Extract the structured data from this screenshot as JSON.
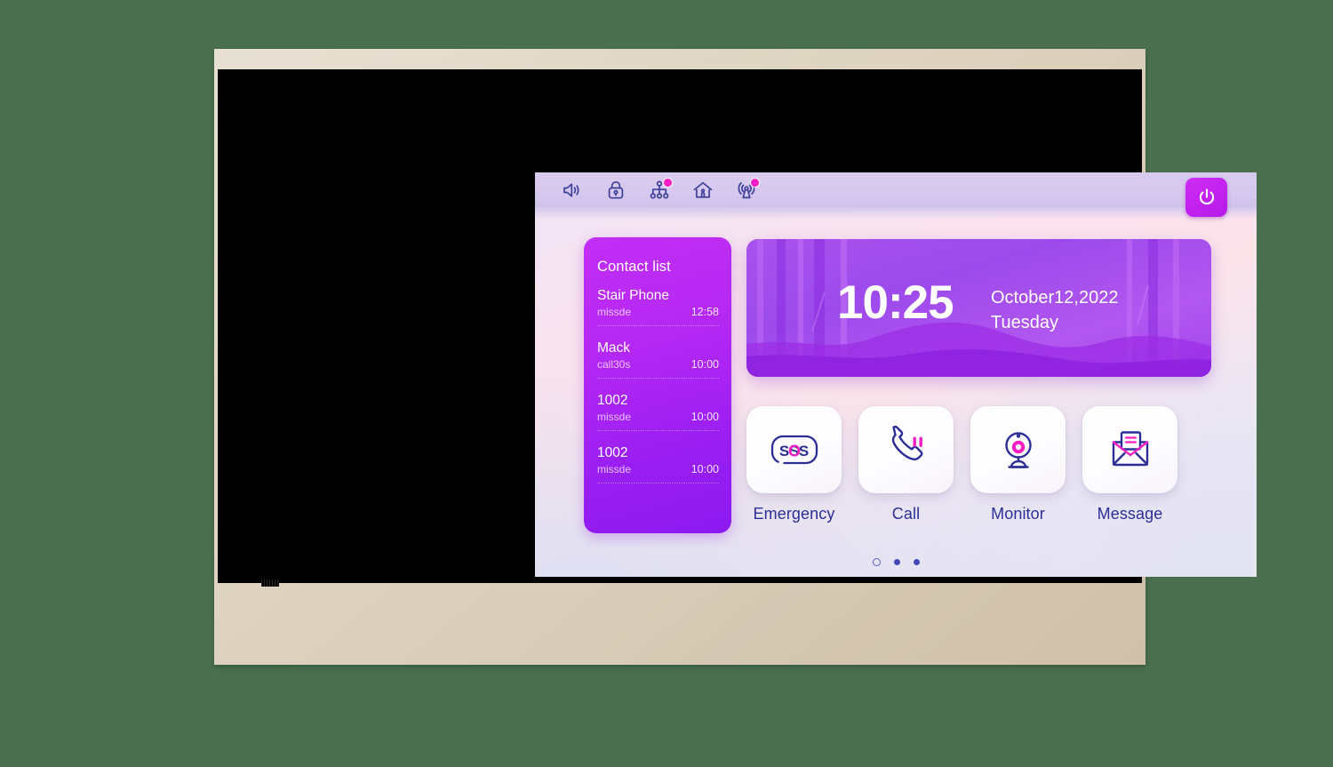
{
  "device": {
    "frame_color": "#ddd2bf",
    "bezel_color": "#000000",
    "speaker_grille": "speaker-grille"
  },
  "statusbar": {
    "background": "#d6c8ee",
    "icons": [
      {
        "name": "volume-icon",
        "label": "Volume",
        "badge": false
      },
      {
        "name": "lock-icon",
        "label": "Lock",
        "badge": false
      },
      {
        "name": "network-tree-icon",
        "label": "Network",
        "badge": true
      },
      {
        "name": "home-indoor-icon",
        "label": "Indoor Unit",
        "badge": false
      },
      {
        "name": "antenna-signal-icon",
        "label": "Signal",
        "badge": true
      }
    ],
    "badge_color": "#f81ec4",
    "power_button": {
      "name": "power-button",
      "label": "Power",
      "color": "#c322ef"
    }
  },
  "contact_panel": {
    "title": "Contact list",
    "accent": "#a423f3",
    "items": [
      {
        "name": "Stair Phone",
        "status": "missde",
        "time": "12:58"
      },
      {
        "name": "Mack",
        "status": "call30s",
        "time": "10:00"
      },
      {
        "name": "1002",
        "status": "missde",
        "time": "10:00"
      },
      {
        "name": "1002",
        "status": "missde",
        "time": "10:00"
      }
    ]
  },
  "clock_widget": {
    "time": "10:25",
    "date": "October12,2022",
    "weekday": "Tuesday",
    "background": "#a851ee"
  },
  "apps": [
    {
      "id": "emergency",
      "label": "Emergency",
      "icon": "sos-icon",
      "accent": "#f81ec4"
    },
    {
      "id": "call",
      "label": "Call",
      "icon": "phone-handset-icon",
      "accent": "#f81ec4"
    },
    {
      "id": "monitor",
      "label": "Monitor",
      "icon": "webcam-icon",
      "accent": "#f81ec4"
    },
    {
      "id": "message",
      "label": "Message",
      "icon": "envelope-message-icon",
      "accent": "#f81ec4"
    }
  ],
  "pager": {
    "pages": 3,
    "active_index": 0
  },
  "theme": {
    "icon_stroke": "#2b2e96",
    "label_color": "#2b2e96",
    "screen_bg": "#f3e5f2"
  }
}
